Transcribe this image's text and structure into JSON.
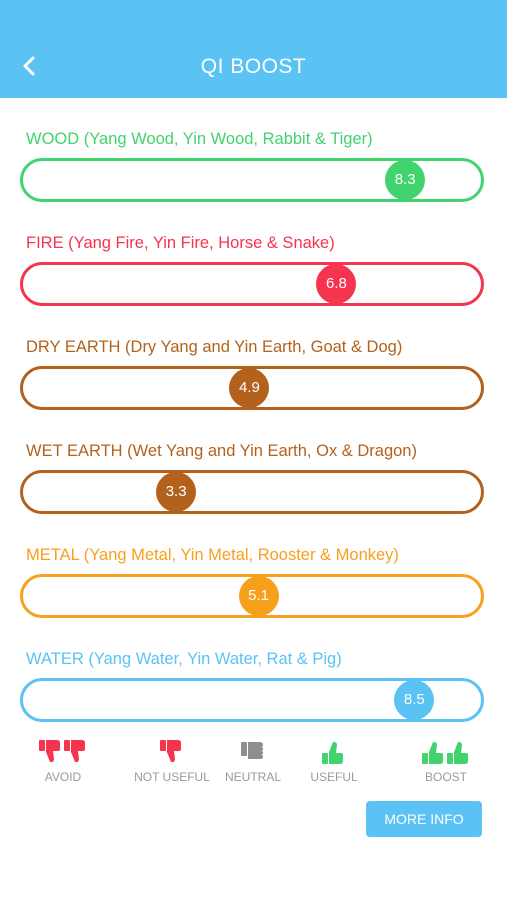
{
  "header": {
    "title": "QI BOOST",
    "back_icon": "chevron-left-icon"
  },
  "elements": [
    {
      "key": "wood",
      "label": "WOOD (Yang Wood, Yin Wood, Rabbit & Tiger)",
      "value": "8.3",
      "level": 0.83,
      "color": "#41d36d"
    },
    {
      "key": "fire",
      "label": "FIRE (Yang Fire, Yin Fire, Horse & Snake)",
      "value": "6.8",
      "level": 0.68,
      "color": "#f5344f"
    },
    {
      "key": "dry-earth",
      "label": "DRY EARTH (Dry Yang and Yin Earth, Goat & Dog)",
      "value": "4.9",
      "level": 0.49,
      "color": "#b3621d"
    },
    {
      "key": "wet-earth",
      "label": "WET EARTH (Wet Yang and Yin Earth, Ox & Dragon)",
      "value": "3.3",
      "level": 0.33,
      "color": "#b3621d"
    },
    {
      "key": "metal",
      "label": "METAL (Yang Metal, Yin Metal, Rooster & Monkey)",
      "value": "5.1",
      "level": 0.51,
      "color": "#f7a01c"
    },
    {
      "key": "water",
      "label": "WATER (Yang Water, Yin Water, Rat & Pig)",
      "value": "8.5",
      "level": 0.85,
      "color": "#5bc2f4"
    }
  ],
  "legend": [
    {
      "label": "AVOID",
      "icon": "double-thumbs-down-icon",
      "color": "#f5344f"
    },
    {
      "label": "NOT USEFUL",
      "icon": "thumbs-down-icon",
      "color": "#f5344f"
    },
    {
      "label": "NEUTRAL",
      "icon": "neutral-hand-icon",
      "color": "#8e8e8e"
    },
    {
      "label": "USEFUL",
      "icon": "thumbs-up-icon",
      "color": "#41d36d"
    },
    {
      "label": "BOOST",
      "icon": "double-thumbs-up-icon",
      "color": "#41d36d"
    }
  ],
  "more_info": {
    "label": "MORE INFO"
  }
}
